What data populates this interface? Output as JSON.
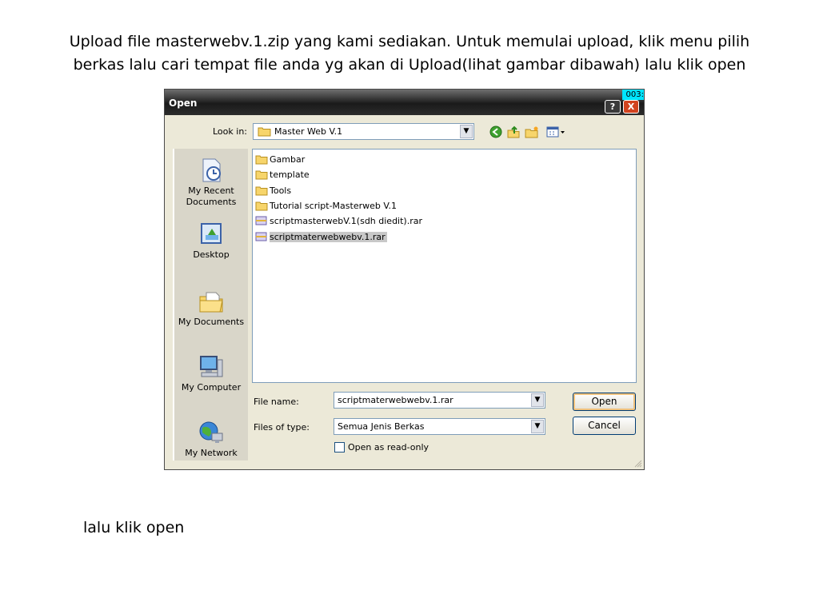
{
  "slide": {
    "instruction_line1": "Upload file masterwebv.1.zip yang kami sediakan. Untuk memulai upload, klik menu pilih",
    "instruction_line2": "berkas lalu cari tempat file anda yg akan di Upload(lihat gambar dibawah) lalu klik open",
    "footer": "lalu klik open"
  },
  "dialog": {
    "title": "Open",
    "counter": "003:",
    "help_label": "?",
    "close_label": "X",
    "look_in_label": "Look in:",
    "look_in_value": "Master Web V.1",
    "places": [
      {
        "label_line1": "My Recent",
        "label_line2": "Documents",
        "icon": "recent-documents-icon"
      },
      {
        "label_line1": "Desktop",
        "label_line2": "",
        "icon": "desktop-icon"
      },
      {
        "label_line1": "My Documents",
        "label_line2": "",
        "icon": "my-documents-icon"
      },
      {
        "label_line1": "My Computer",
        "label_line2": "",
        "icon": "my-computer-icon"
      },
      {
        "label_line1": "My Network",
        "label_line2": "",
        "icon": "my-network-icon"
      }
    ],
    "files": [
      {
        "name": "Gambar",
        "type": "folder"
      },
      {
        "name": "template",
        "type": "folder"
      },
      {
        "name": "Tools",
        "type": "folder"
      },
      {
        "name": "Tutorial script-Masterweb V.1",
        "type": "folder"
      },
      {
        "name": "scriptmasterwebV.1(sdh diedit).rar",
        "type": "rar"
      },
      {
        "name": "scriptmaterwebwebv.1.rar",
        "type": "rar",
        "selected": true
      }
    ],
    "file_name_label": "File name:",
    "file_name_value": "scriptmaterwebwebv.1.rar",
    "files_of_type_label": "Files of type:",
    "files_of_type_value": "Semua Jenis Berkas",
    "open_label": "Open",
    "cancel_label": "Cancel",
    "read_only_label": "Open as read-only"
  }
}
